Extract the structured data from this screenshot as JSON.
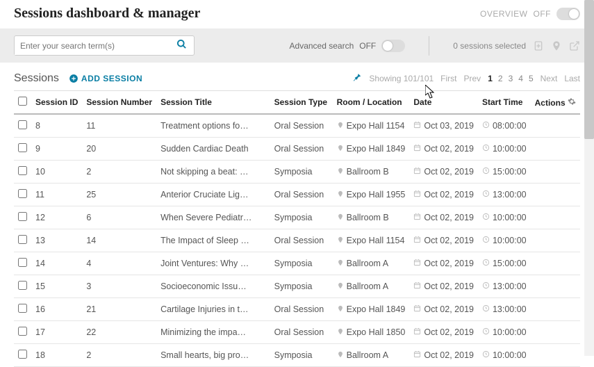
{
  "page": {
    "title": "Sessions dashboard & manager"
  },
  "overview": {
    "label": "OVERVIEW",
    "state": "OFF"
  },
  "search": {
    "placeholder": "Enter your search term(s)",
    "advanced_label": "Advanced search",
    "advanced_state": "OFF"
  },
  "selection": {
    "count_text": "0 sessions selected"
  },
  "subheader": {
    "title": "Sessions",
    "add_label": "ADD SESSION"
  },
  "pager": {
    "showing": "Showing 101/101",
    "first": "First",
    "prev": "Prev",
    "next": "Next",
    "last": "Last",
    "pages": [
      "1",
      "2",
      "3",
      "4",
      "5"
    ],
    "active": "1"
  },
  "columns": {
    "session_id": "Session ID",
    "session_number": "Session Number",
    "session_title": "Session Title",
    "session_type": "Session Type",
    "room": "Room / Location",
    "date": "Date",
    "start": "Start Time",
    "actions": "Actions"
  },
  "rows": [
    {
      "id": "8",
      "num": "11",
      "title": "Treatment options fo…",
      "type": "Oral Session",
      "loc": "Expo Hall 1154",
      "date": "Oct 03, 2019",
      "start": "08:00:00"
    },
    {
      "id": "9",
      "num": "20",
      "title": "Sudden Cardiac Death",
      "type": "Oral Session",
      "loc": "Expo Hall 1849",
      "date": "Oct 02, 2019",
      "start": "10:00:00"
    },
    {
      "id": "10",
      "num": "2",
      "title": "Not skipping a beat: …",
      "type": "Symposia",
      "loc": "Ballroom B",
      "date": "Oct 02, 2019",
      "start": "15:00:00"
    },
    {
      "id": "11",
      "num": "25",
      "title": "Anterior Cruciate Lig…",
      "type": "Oral Session",
      "loc": "Expo Hall 1955",
      "date": "Oct 02, 2019",
      "start": "13:00:00"
    },
    {
      "id": "12",
      "num": "6",
      "title": "When Severe Pediatr…",
      "type": "Symposia",
      "loc": "Ballroom B",
      "date": "Oct 02, 2019",
      "start": "10:00:00"
    },
    {
      "id": "13",
      "num": "14",
      "title": "The Impact of Sleep …",
      "type": "Oral Session",
      "loc": "Expo Hall 1154",
      "date": "Oct 02, 2019",
      "start": "10:00:00"
    },
    {
      "id": "14",
      "num": "4",
      "title": "Joint Ventures: Why …",
      "type": "Symposia",
      "loc": "Ballroom A",
      "date": "Oct 02, 2019",
      "start": "15:00:00"
    },
    {
      "id": "15",
      "num": "3",
      "title": "Socioeconomic Issu…",
      "type": "Symposia",
      "loc": "Ballroom A",
      "date": "Oct 02, 2019",
      "start": "13:00:00"
    },
    {
      "id": "16",
      "num": "21",
      "title": "Cartilage Injuries in t…",
      "type": "Oral Session",
      "loc": "Expo Hall 1849",
      "date": "Oct 02, 2019",
      "start": "13:00:00"
    },
    {
      "id": "17",
      "num": "22",
      "title": "Minimizing the impa…",
      "type": "Oral Session",
      "loc": "Expo Hall 1850",
      "date": "Oct 02, 2019",
      "start": "10:00:00"
    },
    {
      "id": "18",
      "num": "2",
      "title": "Small hearts, big pro…",
      "type": "Symposia",
      "loc": "Ballroom A",
      "date": "Oct 02, 2019",
      "start": "10:00:00"
    }
  ]
}
